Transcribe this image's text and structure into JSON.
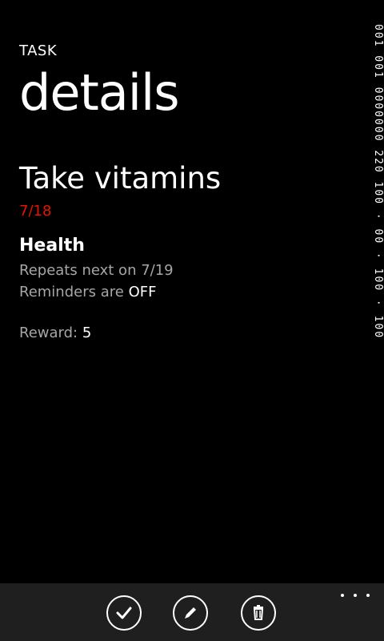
{
  "header": {
    "app_title": "TASK",
    "page_title": "details"
  },
  "task": {
    "name": "Take vitamins",
    "due_date": "7/18",
    "category": "Health",
    "repeats_label": "Repeats next on 7/19",
    "reminders_label": "Reminders are",
    "reminders_value": "OFF",
    "reward_label": "Reward:",
    "reward_value": "5"
  },
  "debug_strip": {
    "text": "001 001 0000000 220 100 · 00 · 100 · 100"
  },
  "app_bar": {
    "buttons": [
      {
        "name": "complete",
        "icon": "check-icon"
      },
      {
        "name": "edit",
        "icon": "pencil-icon"
      },
      {
        "name": "delete",
        "icon": "trash-icon"
      }
    ],
    "more_label": "..."
  },
  "colors": {
    "background": "#000000",
    "foreground": "#ffffff",
    "secondary_text": "#a6a6a6",
    "accent": "#e51400",
    "app_bar": "#1f1f1f"
  }
}
